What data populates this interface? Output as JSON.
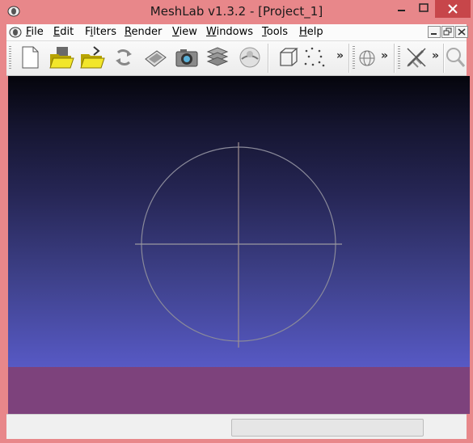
{
  "window": {
    "title": "MeshLab v1.3.2 - [Project_1]",
    "controls": {
      "minimize": "minimize-icon",
      "maximize": "maximize-icon",
      "close": "close-icon"
    }
  },
  "menubar": {
    "items": [
      {
        "label": "File",
        "mnemonic": "F"
      },
      {
        "label": "Edit",
        "mnemonic": "E"
      },
      {
        "label": "Filters",
        "mnemonic": "i"
      },
      {
        "label": "Render",
        "mnemonic": "R"
      },
      {
        "label": "View",
        "mnemonic": "V"
      },
      {
        "label": "Windows",
        "mnemonic": "W"
      },
      {
        "label": "Tools",
        "mnemonic": "T"
      },
      {
        "label": "Help",
        "mnemonic": "H"
      }
    ],
    "mdi_controls": [
      "restore-child-icon",
      "tile-child-icon",
      "close-child-icon"
    ]
  },
  "toolbar": {
    "buttons": [
      "new-project-icon",
      "open-project-icon",
      "import-mesh-icon",
      "reload-icon",
      "save-snapshot-icon",
      "snapshot-camera-icon",
      "layers-icon",
      "align-icon",
      "bounding-box-icon",
      "points-icon",
      "sphere-light-icon",
      "select-clear-icon",
      "zoom-icon"
    ],
    "overflow_glyph": "»"
  },
  "colors": {
    "titlebar": "#e8878a",
    "close_button": "#c7464a",
    "viewport_top": "#05050c",
    "viewport_bottom": "#6a6ddc",
    "ground": "#7d427c",
    "trackball": "#7a7a8a"
  }
}
